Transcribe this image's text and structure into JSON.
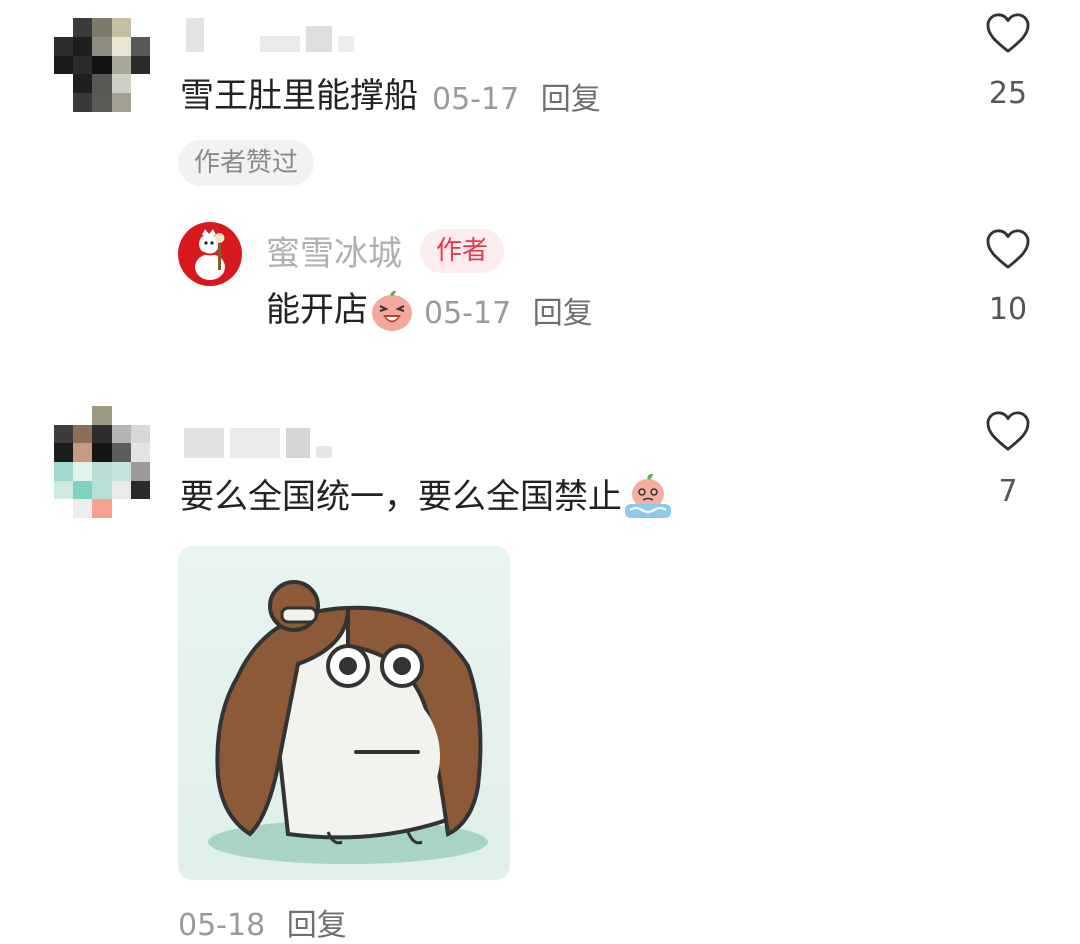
{
  "comments": [
    {
      "text": "雪王肚里能撑船",
      "date": "05-17",
      "reply_label": "回复",
      "likes": "25",
      "liked_by_author_tag": "作者赞过",
      "reply": {
        "author": "蜜雪冰城",
        "author_badge": "作者",
        "text": "能开店",
        "emoji_icon": "laughing-peach-emoji-icon",
        "date": "05-17",
        "reply_label": "回复",
        "likes": "10"
      }
    },
    {
      "text": "要么全国统一，要么全国禁止",
      "emoji_icon": "crying-peach-emoji-icon",
      "date": "05-18",
      "reply_label": "回复",
      "likes": "7",
      "sticker_icon": "bun-hair-cartoon-sticker"
    }
  ],
  "colors": {
    "author_badge_text": "#e53b4f",
    "author_badge_bg": "#fdecee",
    "brand_red": "#d7191d",
    "meta_gray": "#9a9a9a"
  }
}
